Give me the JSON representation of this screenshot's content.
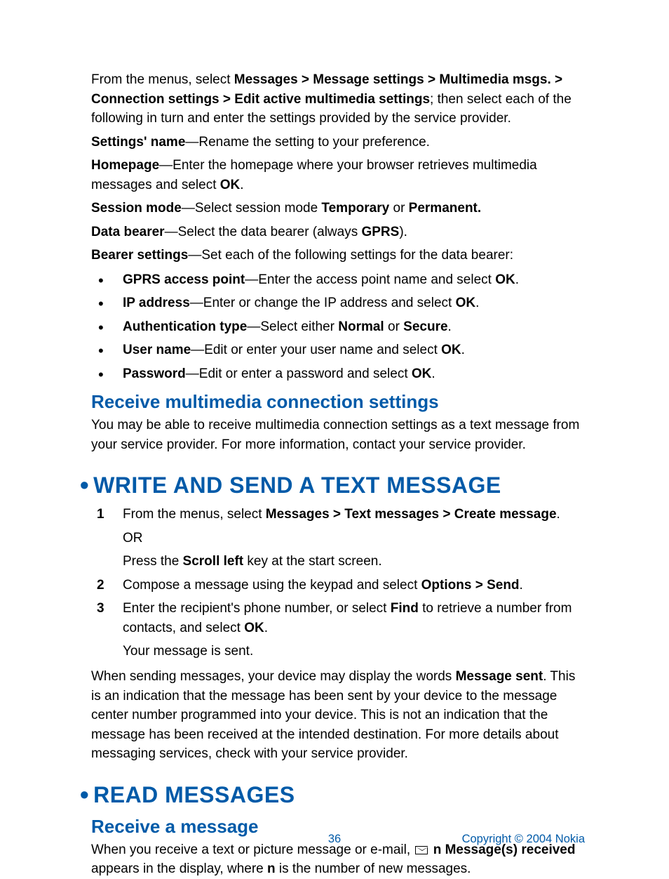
{
  "intro": {
    "prefix": "From the menus, select ",
    "path": "Messages > Message settings > Multimedia msgs. > Connection settings > Edit active multimedia settings",
    "suffix": "; then select each of the following in turn and enter the settings provided by the service provider."
  },
  "settings": {
    "name": {
      "label": "Settings' name",
      "text": "—Rename the setting to your preference."
    },
    "homepage": {
      "label": "Homepage",
      "text1": "—Enter the homepage where your browser retrieves multimedia messages and select ",
      "ok": "OK",
      "text2": "."
    },
    "session": {
      "label": "Session mode",
      "text1": "—Select session mode ",
      "opt1": "Temporary",
      "or": " or ",
      "opt2": "Permanent."
    },
    "bearer": {
      "label": "Data bearer",
      "text1": "—Select the data bearer (always ",
      "gprs": "GPRS",
      "text2": ")."
    },
    "bsettings": {
      "label": "Bearer settings",
      "text": "—Set each of the following settings for the data bearer:"
    }
  },
  "bearer_items": [
    {
      "label": "GPRS access point",
      "text1": "—Enter the access point name and select ",
      "ok": "OK",
      "text2": "."
    },
    {
      "label": "IP address",
      "text1": "—Enter or change the IP address and select ",
      "ok": "OK",
      "text2": "."
    },
    {
      "label": "Authentication type",
      "text1": "—Select either ",
      "opt1": "Normal",
      "or": " or ",
      "opt2": "Secure",
      "text2": "."
    },
    {
      "label": "User name",
      "text1": "—Edit or enter your user name and select ",
      "ok": "OK",
      "text2": "."
    },
    {
      "label": "Password",
      "text1": "—Edit or enter a password and select ",
      "ok": "OK",
      "text2": "."
    }
  ],
  "receive_mm": {
    "heading": "Receive multimedia connection settings",
    "text": "You may be able to receive multimedia connection settings as a text message from your service provider. For more information, contact your service provider."
  },
  "write_send": {
    "heading": "WRITE AND SEND A TEXT MESSAGE",
    "steps": [
      {
        "n": "1",
        "pre": "From the menus, select ",
        "path": "Messages > Text messages > Create message",
        "post": ".",
        "or": "OR",
        "sub_pre": "Press the ",
        "sub_bold": "Scroll left",
        "sub_post": " key at the start screen."
      },
      {
        "n": "2",
        "pre": "Compose a message using the keypad and select ",
        "path": "Options > Send",
        "post": "."
      },
      {
        "n": "3",
        "pre": "Enter the recipient's phone number, or select ",
        "bold1": "Find",
        "mid": " to retrieve a number from contacts, and select ",
        "bold2": "OK",
        "post": ".",
        "sub": "Your message is sent."
      }
    ],
    "note_pre": "When sending messages, your device may display the words ",
    "note_bold": "Message sent",
    "note_post": ". This is an indication that the message has been sent by your device to the message center number programmed into your device. This is not an indication that the message has been received at the intended destination. For more details about messaging services, check with your service provider."
  },
  "read": {
    "heading": "READ MESSAGES",
    "sub": "Receive a message",
    "text_pre": "When you receive a text or picture message or e-mail, ",
    "bold1": "n Message(s) received",
    "text_mid": " appears in the display, where ",
    "bold2": "n",
    "text_post": " is the number of new messages."
  },
  "footer": {
    "page": "36",
    "copyright": "Copyright © 2004 Nokia"
  }
}
